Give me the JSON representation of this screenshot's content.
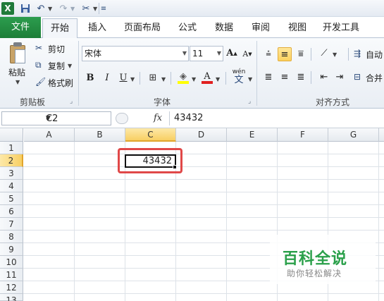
{
  "quick_access": {
    "app_icon": "X",
    "save_icon": "save-icon",
    "undo_icon": "undo-icon",
    "redo_icon": "redo-icon",
    "customize_icon": "customize-icon"
  },
  "tabs": [
    {
      "label": "文件"
    },
    {
      "label": "开始"
    },
    {
      "label": "插入"
    },
    {
      "label": "页面布局"
    },
    {
      "label": "公式"
    },
    {
      "label": "数据"
    },
    {
      "label": "审阅"
    },
    {
      "label": "视图"
    },
    {
      "label": "开发工具"
    }
  ],
  "clipboard": {
    "paste_label": "粘贴",
    "cut_label": "剪切",
    "copy_label": "复制",
    "format_painter_label": "格式刷",
    "group_label": "剪贴板"
  },
  "font": {
    "font_name": "宋体",
    "font_size": "11",
    "bold": "B",
    "italic": "I",
    "underline": "U",
    "grow": "A",
    "shrink": "A",
    "font_color": "A",
    "phonetic": "wén",
    "group_label": "字体"
  },
  "alignment": {
    "wrap_label": "自动",
    "merge_label": "合并",
    "group_label": "对齐方式"
  },
  "formula_bar": {
    "name_box": "C2",
    "fx": "fx",
    "content": "43432"
  },
  "grid": {
    "columns": [
      "A",
      "B",
      "C",
      "D",
      "E",
      "F",
      "G"
    ],
    "rows": [
      "1",
      "2",
      "3",
      "4",
      "5",
      "6",
      "7",
      "8",
      "9",
      "10",
      "11",
      "12",
      "13"
    ],
    "selected_cell_value": "43432"
  },
  "watermark": {
    "title": "百科全说",
    "subtitle": "助你轻松解决"
  }
}
